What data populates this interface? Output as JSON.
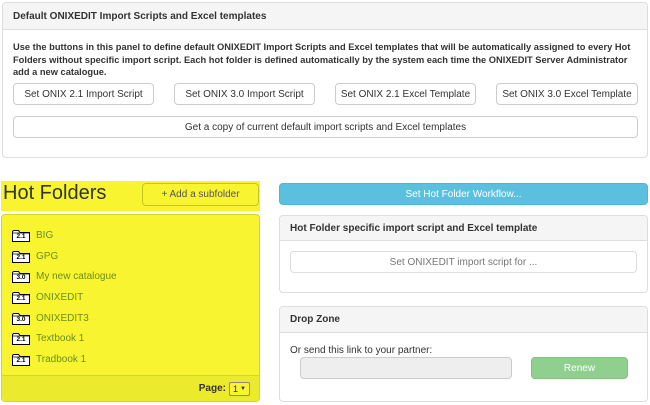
{
  "defaults_panel": {
    "title": "Default ONIXEDIT Import Scripts and Excel templates",
    "description": "Use the buttons in this panel to define default ONIXEDIT Import Scripts and Excel templates that will be automatically assigned to every Hot Folders without specific import script. Each hot folder is defined automatically by the system each time the ONIXEDIT Server Administrator add a new catalogue.",
    "buttons": [
      "Set ONIX 2.1 Import Script",
      "Set ONIX 3.0 Import Script",
      "Set ONIX 2.1 Excel Template",
      "Set ONIX 3.0 Excel Template"
    ],
    "copy_button": "Get a copy of current default import scripts and Excel templates"
  },
  "hot_folders": {
    "title": "Hot Folders",
    "add_subfolder": "+ Add a subfolder",
    "folders": [
      {
        "version": "2.1",
        "name": "BIG"
      },
      {
        "version": "2.1",
        "name": "GPG"
      },
      {
        "version": "3.0",
        "name": "My new catalogue"
      },
      {
        "version": "2.1",
        "name": "ONIXEDIT"
      },
      {
        "version": "3.0",
        "name": "ONIXEDIT3"
      },
      {
        "version": "2.1",
        "name": "Textbook 1"
      },
      {
        "version": "2.1",
        "name": "Tradbook 1"
      }
    ],
    "page_label": "Page:",
    "page_value": "1"
  },
  "workflow_button": "Set Hot Folder Workflow...",
  "specific_panel": {
    "title": "Hot Folder specific import script and Excel template",
    "button": "Set ONIXEDIT import script for ..."
  },
  "drop_zone": {
    "title": "Drop Zone",
    "text": "Or send this link to your partner:",
    "link_value": "",
    "renew_button": "Renew"
  },
  "icons": {
    "folder": "folder-icon",
    "dropdown": "chevron-down-icon"
  },
  "colors": {
    "highlight": "#f8f530",
    "info": "#5bc0de",
    "success": "#8fd08f",
    "folder_link": "#6b8e23"
  }
}
